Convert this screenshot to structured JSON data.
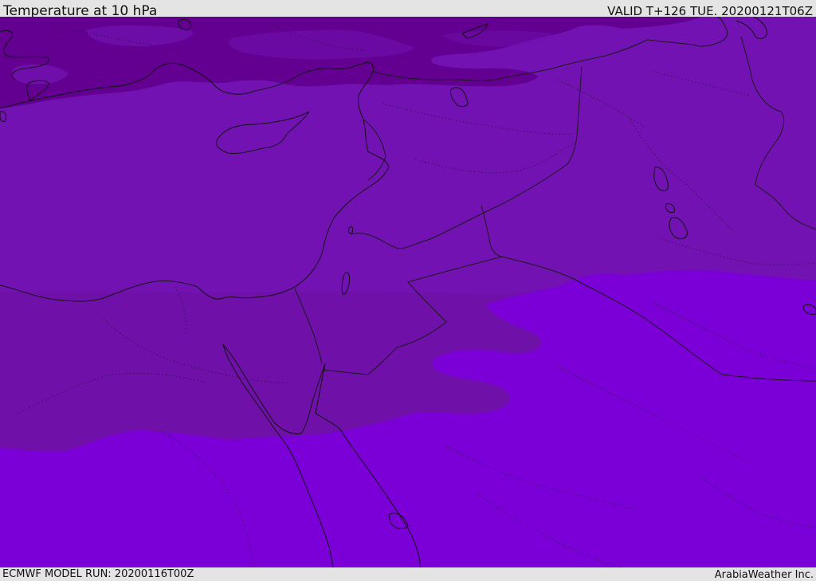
{
  "header": {
    "title": "Temperature at 10 hPa",
    "valid_time": "VALID T+126 TUE. 20200121T06Z"
  },
  "footer": {
    "model_run": "ECMWF MODEL RUN: 20200116T00Z",
    "credit": "ArabiaWeather Inc."
  },
  "map": {
    "colors": {
      "band_coldest": "#630091",
      "band_cold": "#7211b0",
      "band_mid": "#6f10a8",
      "band_warm": "#7b00d8",
      "coastline": "#111111",
      "border": "#1a1a1a"
    }
  }
}
